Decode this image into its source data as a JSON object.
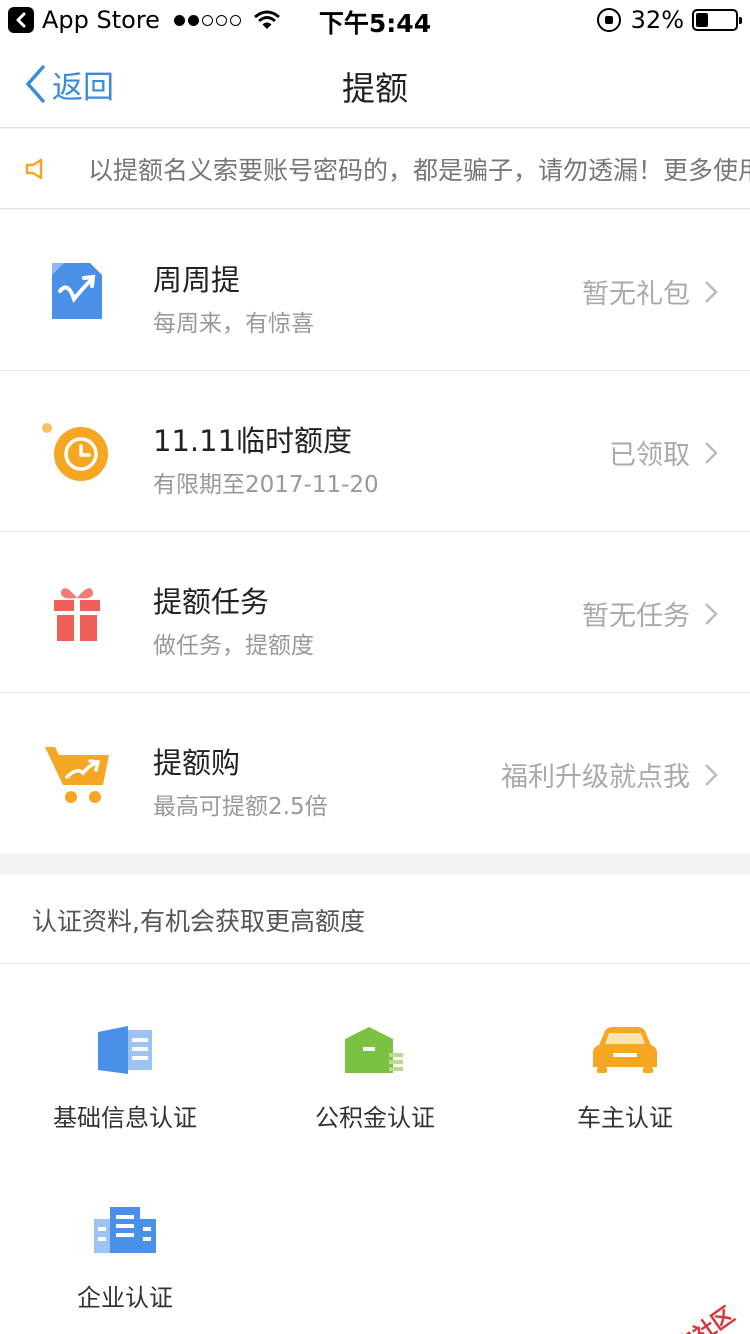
{
  "status_bar": {
    "carrier": "App Store",
    "time": "下午5:44",
    "battery_percent": "32%",
    "battery_level": 0.32
  },
  "nav": {
    "back_label": "返回",
    "title": "提额"
  },
  "notice": {
    "text": "以提额名义索要账号密码的，都是骗子，请勿透漏！更多使用"
  },
  "promos": [
    {
      "title": "周周提",
      "subtitle": "每周来，有惊喜",
      "status": "暂无礼包",
      "icon": "weekly-chart-icon"
    },
    {
      "title": "11.11临时额度",
      "subtitle": "有限期至2017-11-20",
      "status": "已领取",
      "icon": "clock-icon"
    },
    {
      "title": "提额任务",
      "subtitle": "做任务，提额度",
      "status": "暂无任务",
      "icon": "gift-icon"
    },
    {
      "title": "提额购",
      "subtitle": "最高可提额2.5倍",
      "status": "福利升级就点我",
      "icon": "cart-icon"
    }
  ],
  "cert": {
    "header": "认证资料,有机会获取更高额度",
    "items": [
      {
        "label": "基础信息认证",
        "icon": "id-card-icon"
      },
      {
        "label": "公积金认证",
        "icon": "warehouse-icon"
      },
      {
        "label": "车主认证",
        "icon": "car-icon"
      },
      {
        "label": "企业认证",
        "icon": "building-icon"
      }
    ]
  },
  "watermark": "卡农社区",
  "colors": {
    "accent_blue": "#3b8bdc",
    "orange": "#f5a623",
    "red": "#f0605a",
    "green": "#7cc242"
  }
}
